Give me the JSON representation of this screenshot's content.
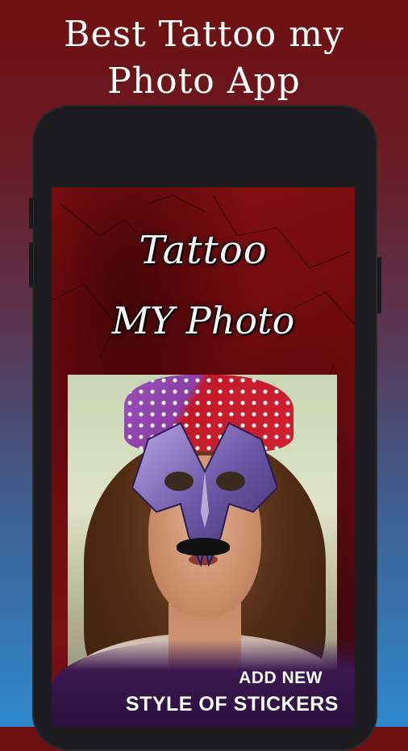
{
  "headline": {
    "line1": "Best Tattoo my",
    "line2": "Photo App"
  },
  "app_title": {
    "line1": "Tattoo",
    "line2": "MY Photo"
  },
  "banner": {
    "line1": "ADD NEW",
    "line2": "STYLE OF STICKERS"
  },
  "colors": {
    "background_top": "#6e0f10",
    "background_bottom": "#2f88cc",
    "phone_body": "#1c1c1e",
    "screen_red": "#8a0f14",
    "banner_purple": "#3b1850"
  }
}
